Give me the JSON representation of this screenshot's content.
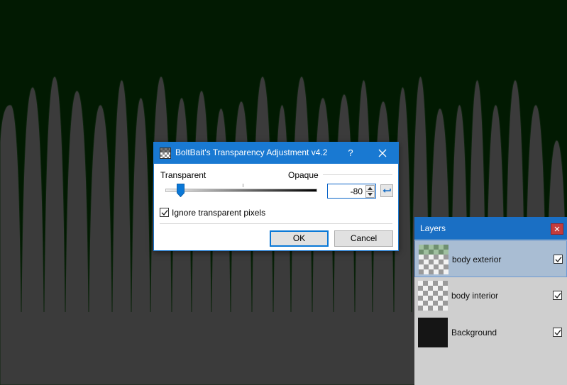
{
  "canvas": {
    "background": "#021a02",
    "shape_fill": "#3b3b3b"
  },
  "dialog": {
    "title": "BoltBait's Transparency Adjustment v4.2",
    "help_label": "?",
    "left_label": "Transparent",
    "right_label": "Opaque",
    "slider_value": -80,
    "value_text": "-80",
    "checkbox_label": "Ignore transparent pixels",
    "checkbox_checked": true,
    "ok_label": "OK",
    "cancel_label": "Cancel",
    "accent_color": "#1979d2"
  },
  "layers_panel": {
    "title": "Layers",
    "layers": [
      {
        "name": "body exterior",
        "visible": true,
        "selected": true
      },
      {
        "name": "body interior",
        "visible": true,
        "selected": false
      },
      {
        "name": "Background",
        "visible": true,
        "selected": false
      }
    ]
  }
}
